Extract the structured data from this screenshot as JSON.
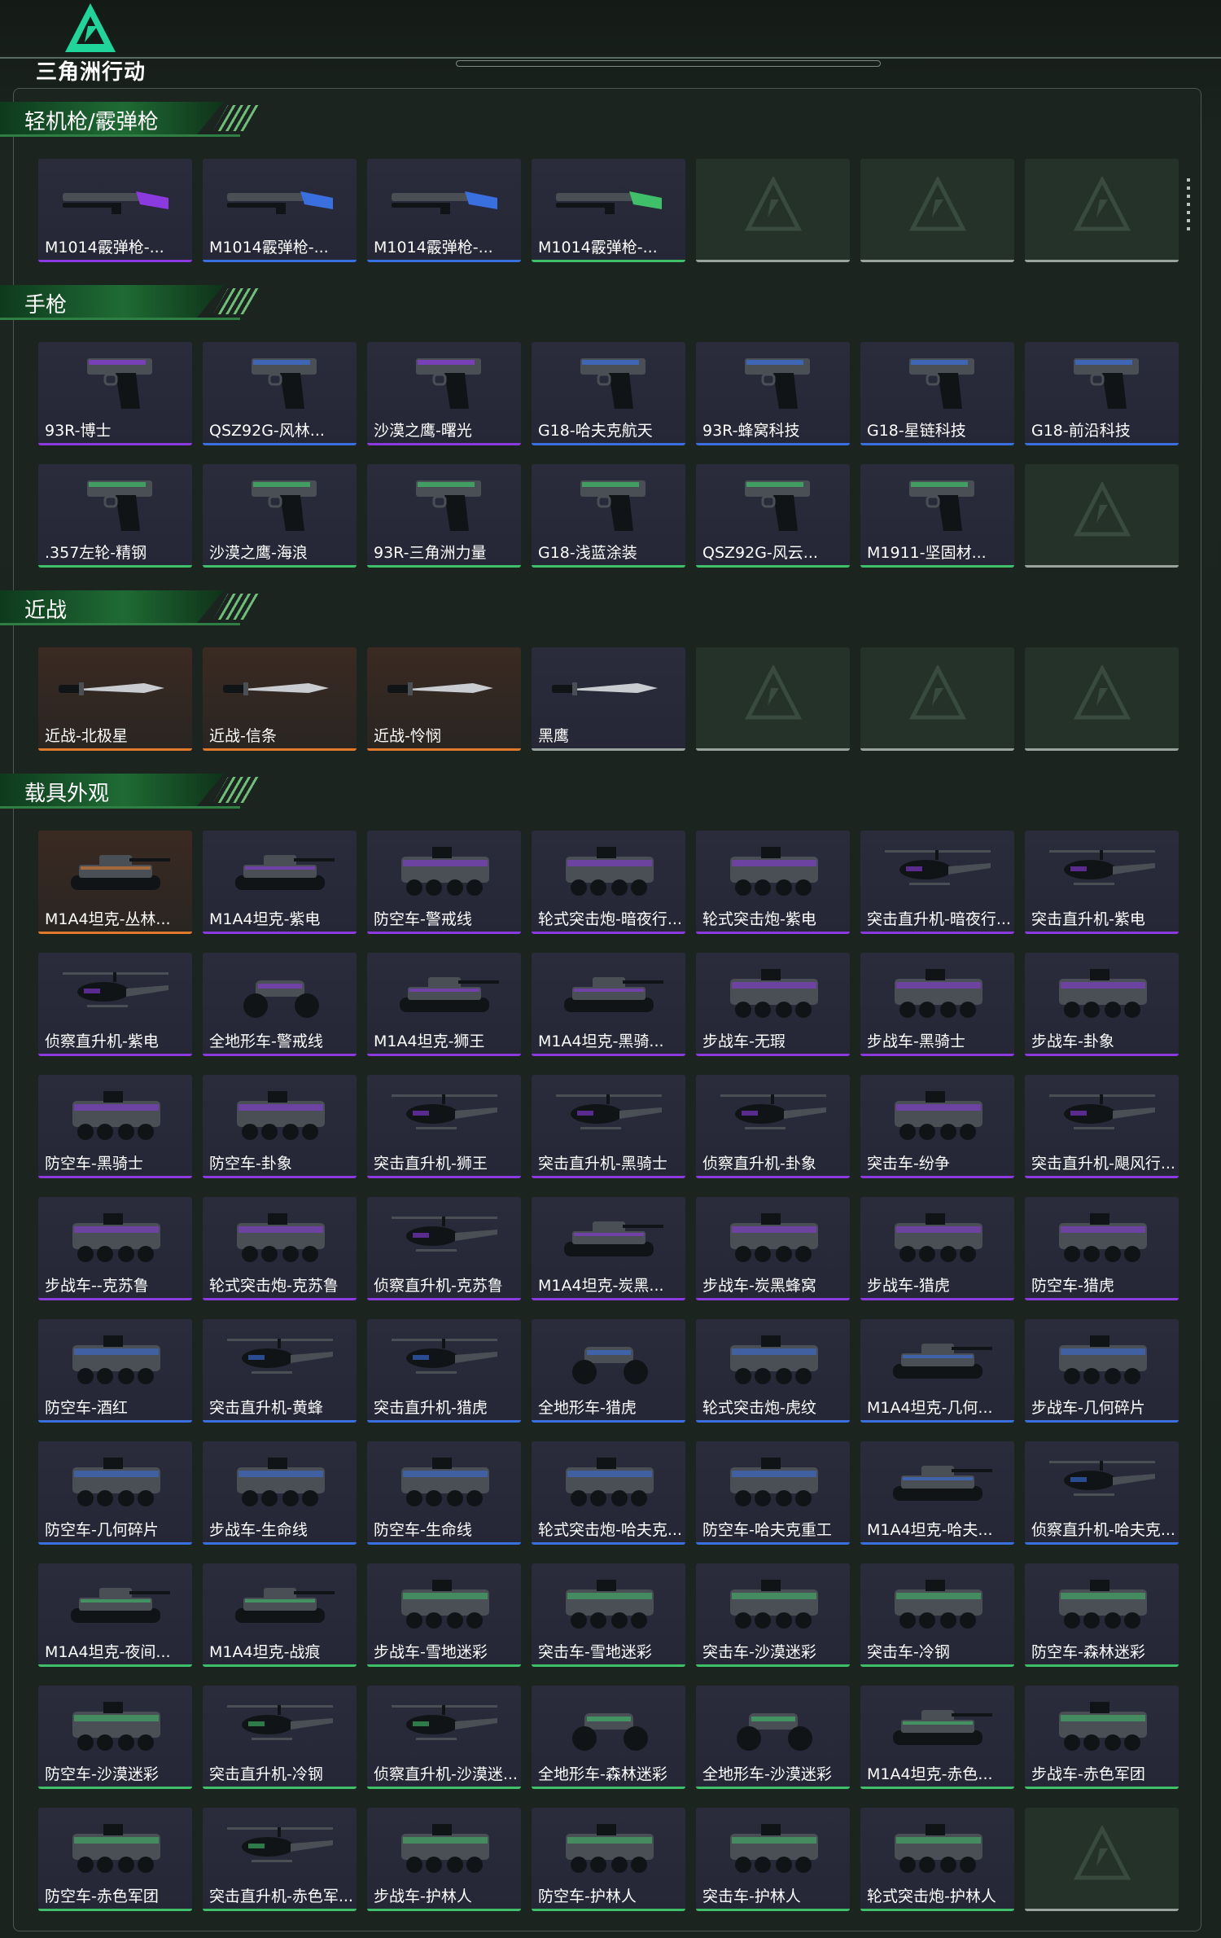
{
  "header": {
    "logo_text": "三角洲行动"
  },
  "colors": {
    "blue": "#3a6fe0",
    "purple": "#8b3ae0",
    "green": "#3fbf6a",
    "orange": "#e07a2a",
    "gray": "#9aa39e",
    "accent": "#2f7f45"
  },
  "sections": [
    {
      "title": "轻机枪/霰弹枪",
      "items": [
        {
          "label": "M1014霰弹枪-...",
          "rarity": "purple",
          "icon": "shotgun-icon"
        },
        {
          "label": "M1014霰弹枪-...",
          "rarity": "blue",
          "icon": "shotgun-icon"
        },
        {
          "label": "M1014霰弹枪-...",
          "rarity": "blue",
          "icon": "shotgun-icon"
        },
        {
          "label": "M1014霰弹枪-...",
          "rarity": "green",
          "icon": "shotgun-icon"
        },
        {
          "label": "",
          "rarity": "gray",
          "icon": ""
        },
        {
          "label": "",
          "rarity": "gray",
          "icon": ""
        },
        {
          "label": "",
          "rarity": "gray",
          "icon": ""
        }
      ]
    },
    {
      "title": "手枪",
      "items": [
        {
          "label": "93R-博士",
          "rarity": "purple",
          "icon": "pistol-icon"
        },
        {
          "label": "QSZ92G-风林...",
          "rarity": "blue",
          "icon": "pistol-icon"
        },
        {
          "label": "沙漠之鹰-曙光",
          "rarity": "purple",
          "icon": "pistol-icon"
        },
        {
          "label": "G18-哈夫克航天",
          "rarity": "blue",
          "icon": "pistol-icon"
        },
        {
          "label": "93R-蜂窝科技",
          "rarity": "blue",
          "icon": "pistol-icon"
        },
        {
          "label": "G18-星链科技",
          "rarity": "blue",
          "icon": "pistol-icon"
        },
        {
          "label": "G18-前沿科技",
          "rarity": "blue",
          "icon": "pistol-icon"
        },
        {
          "label": ".357左轮-精钢",
          "rarity": "green",
          "icon": "revolver-icon"
        },
        {
          "label": "沙漠之鹰-海浪",
          "rarity": "green",
          "icon": "pistol-icon"
        },
        {
          "label": "93R-三角洲力量",
          "rarity": "green",
          "icon": "pistol-icon"
        },
        {
          "label": "G18-浅蓝涂装",
          "rarity": "green",
          "icon": "pistol-icon"
        },
        {
          "label": "QSZ92G-风云...",
          "rarity": "green",
          "icon": "pistol-icon"
        },
        {
          "label": "M1911-坚固材...",
          "rarity": "green",
          "icon": "pistol-icon"
        },
        {
          "label": "",
          "rarity": "gray",
          "icon": ""
        }
      ]
    },
    {
      "title": "近战",
      "items": [
        {
          "label": "近战-北极星",
          "rarity": "orange",
          "icon": "knife-icon"
        },
        {
          "label": "近战-信条",
          "rarity": "orange",
          "icon": "knife-icon"
        },
        {
          "label": "近战-怜悯",
          "rarity": "orange",
          "icon": "knife-icon"
        },
        {
          "label": "黑鹰",
          "rarity": "gray",
          "icon": "knife-icon"
        },
        {
          "label": "",
          "rarity": "gray",
          "icon": ""
        },
        {
          "label": "",
          "rarity": "gray",
          "icon": ""
        },
        {
          "label": "",
          "rarity": "gray",
          "icon": ""
        }
      ]
    },
    {
      "title": "载具外观",
      "items": [
        {
          "label": "M1A4坦克-丛林...",
          "rarity": "orange",
          "icon": "tank-icon"
        },
        {
          "label": "M1A4坦克-紫电",
          "rarity": "purple",
          "icon": "tank-icon"
        },
        {
          "label": "防空车-警戒线",
          "rarity": "purple",
          "icon": "apc-icon"
        },
        {
          "label": "轮式突击炮-暗夜行...",
          "rarity": "purple",
          "icon": "apc-icon"
        },
        {
          "label": "轮式突击炮-紫电",
          "rarity": "purple",
          "icon": "apc-icon"
        },
        {
          "label": "突击直升机-暗夜行...",
          "rarity": "purple",
          "icon": "helicopter-icon"
        },
        {
          "label": "突击直升机-紫电",
          "rarity": "purple",
          "icon": "helicopter-icon"
        },
        {
          "label": "侦察直升机-紫电",
          "rarity": "purple",
          "icon": "helicopter-icon"
        },
        {
          "label": "全地形车-警戒线",
          "rarity": "purple",
          "icon": "atv-icon"
        },
        {
          "label": "M1A4坦克-狮王",
          "rarity": "purple",
          "icon": "tank-icon"
        },
        {
          "label": "M1A4坦克-黑骑...",
          "rarity": "purple",
          "icon": "tank-icon"
        },
        {
          "label": "步战车-无瑕",
          "rarity": "purple",
          "icon": "apc-icon"
        },
        {
          "label": "步战车-黑骑士",
          "rarity": "purple",
          "icon": "apc-icon"
        },
        {
          "label": "步战车-卦象",
          "rarity": "purple",
          "icon": "apc-icon"
        },
        {
          "label": "防空车-黑骑士",
          "rarity": "purple",
          "icon": "apc-icon"
        },
        {
          "label": "防空车-卦象",
          "rarity": "purple",
          "icon": "apc-icon"
        },
        {
          "label": "突击直升机-狮王",
          "rarity": "purple",
          "icon": "helicopter-icon"
        },
        {
          "label": "突击直升机-黑骑士",
          "rarity": "purple",
          "icon": "helicopter-icon"
        },
        {
          "label": "侦察直升机-卦象",
          "rarity": "purple",
          "icon": "helicopter-icon"
        },
        {
          "label": "突击车-纷争",
          "rarity": "purple",
          "icon": "truck-icon"
        },
        {
          "label": "突击直升机-飓风行...",
          "rarity": "purple",
          "icon": "helicopter-icon"
        },
        {
          "label": "步战车--克苏鲁",
          "rarity": "purple",
          "icon": "apc-icon"
        },
        {
          "label": "轮式突击炮-克苏鲁",
          "rarity": "purple",
          "icon": "apc-icon"
        },
        {
          "label": "侦察直升机-克苏鲁",
          "rarity": "purple",
          "icon": "helicopter-icon"
        },
        {
          "label": "M1A4坦克-炭黑...",
          "rarity": "purple",
          "icon": "tank-icon"
        },
        {
          "label": "步战车-炭黑蜂窝",
          "rarity": "purple",
          "icon": "apc-icon"
        },
        {
          "label": "步战车-猎虎",
          "rarity": "purple",
          "icon": "apc-icon"
        },
        {
          "label": "防空车-猎虎",
          "rarity": "purple",
          "icon": "apc-icon"
        },
        {
          "label": "防空车-酒红",
          "rarity": "blue",
          "icon": "apc-icon"
        },
        {
          "label": "突击直升机-黄蜂",
          "rarity": "blue",
          "icon": "helicopter-icon"
        },
        {
          "label": "突击直升机-猎虎",
          "rarity": "blue",
          "icon": "helicopter-icon"
        },
        {
          "label": "全地形车-猎虎",
          "rarity": "blue",
          "icon": "atv-icon"
        },
        {
          "label": "轮式突击炮-虎纹",
          "rarity": "blue",
          "icon": "apc-icon"
        },
        {
          "label": "M1A4坦克-几何...",
          "rarity": "blue",
          "icon": "tank-icon"
        },
        {
          "label": "步战车-几何碎片",
          "rarity": "blue",
          "icon": "apc-icon"
        },
        {
          "label": "防空车-几何碎片",
          "rarity": "blue",
          "icon": "apc-icon"
        },
        {
          "label": "步战车-生命线",
          "rarity": "blue",
          "icon": "apc-icon"
        },
        {
          "label": "防空车-生命线",
          "rarity": "blue",
          "icon": "apc-icon"
        },
        {
          "label": "轮式突击炮-哈夫克...",
          "rarity": "blue",
          "icon": "apc-icon"
        },
        {
          "label": "防空车-哈夫克重工",
          "rarity": "blue",
          "icon": "apc-icon"
        },
        {
          "label": "M1A4坦克-哈夫...",
          "rarity": "blue",
          "icon": "tank-icon"
        },
        {
          "label": "侦察直升机-哈夫克...",
          "rarity": "blue",
          "icon": "helicopter-icon"
        },
        {
          "label": "M1A4坦克-夜间...",
          "rarity": "green",
          "icon": "tank-icon"
        },
        {
          "label": "M1A4坦克-战痕",
          "rarity": "green",
          "icon": "tank-icon"
        },
        {
          "label": "步战车-雪地迷彩",
          "rarity": "green",
          "icon": "apc-icon"
        },
        {
          "label": "突击车-雪地迷彩",
          "rarity": "green",
          "icon": "truck-icon"
        },
        {
          "label": "突击车-沙漠迷彩",
          "rarity": "green",
          "icon": "truck-icon"
        },
        {
          "label": "突击车-冷钢",
          "rarity": "green",
          "icon": "truck-icon"
        },
        {
          "label": "防空车-森林迷彩",
          "rarity": "green",
          "icon": "apc-icon"
        },
        {
          "label": "防空车-沙漠迷彩",
          "rarity": "green",
          "icon": "apc-icon"
        },
        {
          "label": "突击直升机-冷钢",
          "rarity": "green",
          "icon": "helicopter-icon"
        },
        {
          "label": "侦察直升机-沙漠迷...",
          "rarity": "green",
          "icon": "helicopter-icon"
        },
        {
          "label": "全地形车-森林迷彩",
          "rarity": "green",
          "icon": "atv-icon"
        },
        {
          "label": "全地形车-沙漠迷彩",
          "rarity": "green",
          "icon": "atv-icon"
        },
        {
          "label": "M1A4坦克-赤色...",
          "rarity": "green",
          "icon": "tank-icon"
        },
        {
          "label": "步战车-赤色军团",
          "rarity": "green",
          "icon": "apc-icon"
        },
        {
          "label": "防空车-赤色军团",
          "rarity": "green",
          "icon": "apc-icon"
        },
        {
          "label": "突击直升机-赤色军...",
          "rarity": "green",
          "icon": "helicopter-icon"
        },
        {
          "label": "步战车-护林人",
          "rarity": "green",
          "icon": "apc-icon"
        },
        {
          "label": "防空车-护林人",
          "rarity": "green",
          "icon": "apc-icon"
        },
        {
          "label": "突击车-护林人",
          "rarity": "green",
          "icon": "truck-icon"
        },
        {
          "label": "轮式突击炮-护林人",
          "rarity": "green",
          "icon": "apc-icon"
        },
        {
          "label": "",
          "rarity": "gray",
          "icon": ""
        }
      ]
    }
  ]
}
